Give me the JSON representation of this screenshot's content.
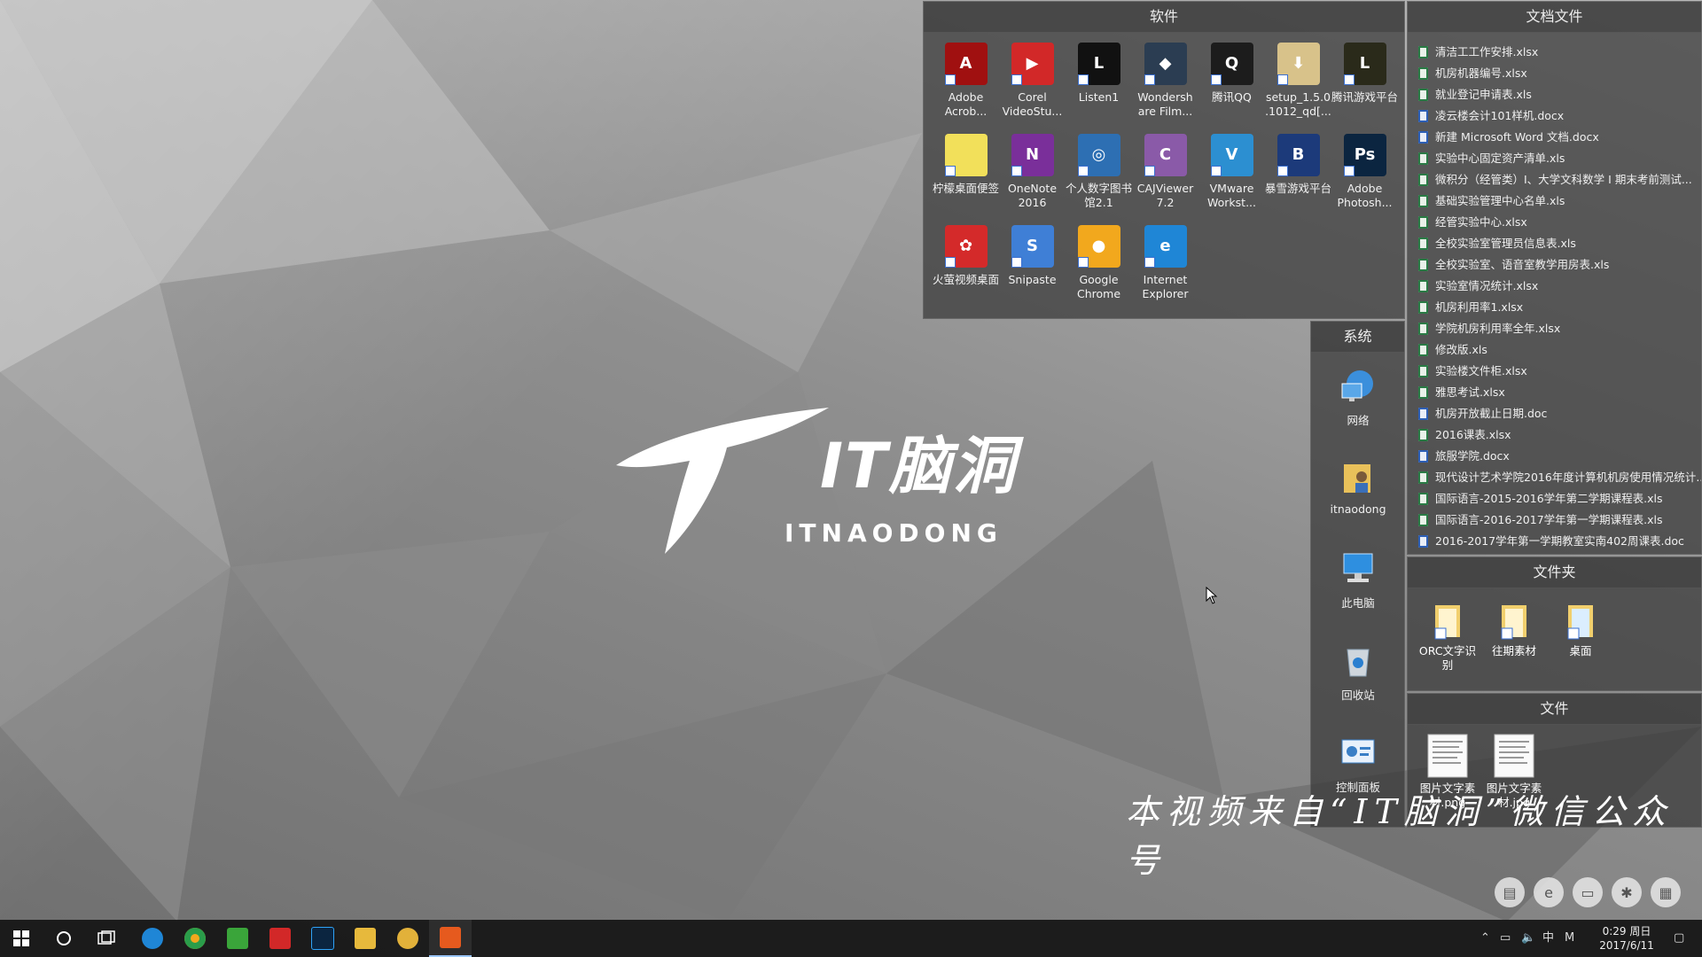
{
  "wallpaper": {
    "logo_cn": "IT脑洞",
    "logo_en": "ITNAODONG",
    "watermark": "本视频来自“IT脑洞”微信公众号"
  },
  "software_panel": {
    "title": "软件",
    "apps": [
      {
        "label": "Adobe Acrob...",
        "icon": "adobe-acrobat-icon",
        "color": "#a01010",
        "glyph": "A"
      },
      {
        "label": "Corel VideoStu...",
        "icon": "corel-videostudio-icon",
        "color": "#d22828",
        "glyph": "▶"
      },
      {
        "label": "Listen1",
        "icon": "listen1-icon",
        "color": "#111111",
        "glyph": "L"
      },
      {
        "label": "Wondersh are Film...",
        "icon": "wondershare-filmora-icon",
        "color": "#2b3d52",
        "glyph": "◆"
      },
      {
        "label": "腾讯QQ",
        "icon": "qq-penguin-icon",
        "color": "#1c1c1c",
        "glyph": "Q"
      },
      {
        "label": "setup_1.5.0 .1012_qd[...",
        "icon": "setup-installer-icon",
        "color": "#d8c28a",
        "glyph": "⬇"
      },
      {
        "label": "腾讯游戏平台",
        "icon": "tencent-games-icon",
        "color": "#2a2a1a",
        "glyph": "L"
      },
      {
        "label": "柠檬桌面便签",
        "icon": "lemon-sticky-note-icon",
        "color": "#f2e05a",
        "glyph": ""
      },
      {
        "label": "OneNote 2016",
        "icon": "onenote-icon",
        "color": "#7a2f9a",
        "glyph": "N"
      },
      {
        "label": "个人数字图书馆2.1",
        "icon": "digital-library-globe-icon",
        "color": "#2d6fb3",
        "glyph": "◎"
      },
      {
        "label": "CAJViewer 7.2",
        "icon": "cajviewer-icon",
        "color": "#8a5aa8",
        "glyph": "C"
      },
      {
        "label": "VMware Workst...",
        "icon": "vmware-workstation-icon",
        "color": "#2c8fd1",
        "glyph": "V"
      },
      {
        "label": "暴雪游戏平台",
        "icon": "blizzard-icon",
        "color": "#1c3a7a",
        "glyph": "B"
      },
      {
        "label": "Adobe Photosh...",
        "icon": "photoshop-icon",
        "color": "#0b2540",
        "glyph": "Ps"
      },
      {
        "label": "火萤视频桌面",
        "icon": "huoying-video-desktop-icon",
        "color": "#d42a2a",
        "glyph": "✿"
      },
      {
        "label": "Snipaste",
        "icon": "snipaste-icon",
        "color": "#3f7fd6",
        "glyph": "S"
      },
      {
        "label": "Google Chrome",
        "icon": "chrome-icon",
        "color": "#f2a81d",
        "glyph": "●"
      },
      {
        "label": "Internet Explorer",
        "icon": "internet-explorer-icon",
        "color": "#1f86d6",
        "glyph": "e"
      }
    ]
  },
  "documents_panel": {
    "title": "文档文件",
    "files": [
      {
        "name": "清洁工工作安排.xlsx",
        "type": "x"
      },
      {
        "name": "机房机器编号.xlsx",
        "type": "x"
      },
      {
        "name": "就业登记申请表.xls",
        "type": "x"
      },
      {
        "name": "凌云楼会计101样机.docx",
        "type": "w"
      },
      {
        "name": "新建 Microsoft Word 文档.docx",
        "type": "w"
      },
      {
        "name": "实验中心固定资产清单.xls",
        "type": "x"
      },
      {
        "name": "微积分（经管类）I、大学文科数学 I 期末考前测试...",
        "type": "x"
      },
      {
        "name": "基础实验管理中心名单.xls",
        "type": "x"
      },
      {
        "name": "经管实验中心.xlsx",
        "type": "x"
      },
      {
        "name": "全校实验室管理员信息表.xls",
        "type": "x"
      },
      {
        "name": "全校实验室、语音室教学用房表.xls",
        "type": "x"
      },
      {
        "name": "实验室情况统计.xlsx",
        "type": "x"
      },
      {
        "name": "机房利用率1.xlsx",
        "type": "x"
      },
      {
        "name": "学院机房利用率全年.xlsx",
        "type": "x"
      },
      {
        "name": "修改版.xls",
        "type": "x"
      },
      {
        "name": "实验楼文件柜.xlsx",
        "type": "x"
      },
      {
        "name": "雅思考试.xlsx",
        "type": "x"
      },
      {
        "name": "机房开放截止日期.doc",
        "type": "w"
      },
      {
        "name": "2016课表.xlsx",
        "type": "x"
      },
      {
        "name": "旅服学院.docx",
        "type": "w"
      },
      {
        "name": "现代设计艺术学院2016年度计算机机房使用情况统计...",
        "type": "x"
      },
      {
        "name": "国际语言-2015-2016学年第二学期课程表.xls",
        "type": "x"
      },
      {
        "name": "国际语言-2016-2017学年第一学期课程表.xls",
        "type": "x"
      },
      {
        "name": "2016-2017学年第一学期教室实南402周课表.doc",
        "type": "w"
      }
    ]
  },
  "system_panel": {
    "title": "系统",
    "items": [
      {
        "label": "网络",
        "icon": "network-globe-icon"
      },
      {
        "label": "itnaodong",
        "icon": "user-folder-icon"
      },
      {
        "label": "此电脑",
        "icon": "this-pc-icon"
      },
      {
        "label": "回收站",
        "icon": "recycle-bin-icon"
      },
      {
        "label": "控制面板",
        "icon": "control-panel-icon"
      }
    ]
  },
  "folders_panel": {
    "title": "文件夹",
    "items": [
      {
        "label": "ORC文字识别"
      },
      {
        "label": "往期素材"
      },
      {
        "label": "桌面"
      }
    ]
  },
  "files_panel": {
    "title": "文件",
    "items": [
      {
        "label": "图片文字素材.png"
      },
      {
        "label": "图片文字素材.jpg"
      }
    ]
  },
  "taskbar": {
    "apps": [
      {
        "icon": "start-windows-icon",
        "color": "#ffffff"
      },
      {
        "icon": "cortana-search-icon",
        "color": "#ffffff"
      },
      {
        "icon": "task-view-icon",
        "color": "#ffffff"
      },
      {
        "icon": "edge-icon",
        "color": "#1f86d6"
      },
      {
        "icon": "chrome-icon",
        "color": "#f2a81d"
      },
      {
        "icon": "camtasia-icon",
        "color": "#3aa53a"
      },
      {
        "icon": "corel-videostudio-icon",
        "color": "#d22828"
      },
      {
        "icon": "photoshop-icon",
        "color": "#0b2540"
      },
      {
        "icon": "file-explorer-icon",
        "color": "#e7b93c"
      },
      {
        "icon": "tencent-games-icon",
        "color": "#e2b13a"
      },
      {
        "icon": "camtasia-recorder-icon",
        "color": "#e65a1e"
      }
    ],
    "tray": {
      "ime": "中",
      "ime_mode": "M",
      "time": "0:29 周日",
      "date": "2017/6/11"
    }
  }
}
